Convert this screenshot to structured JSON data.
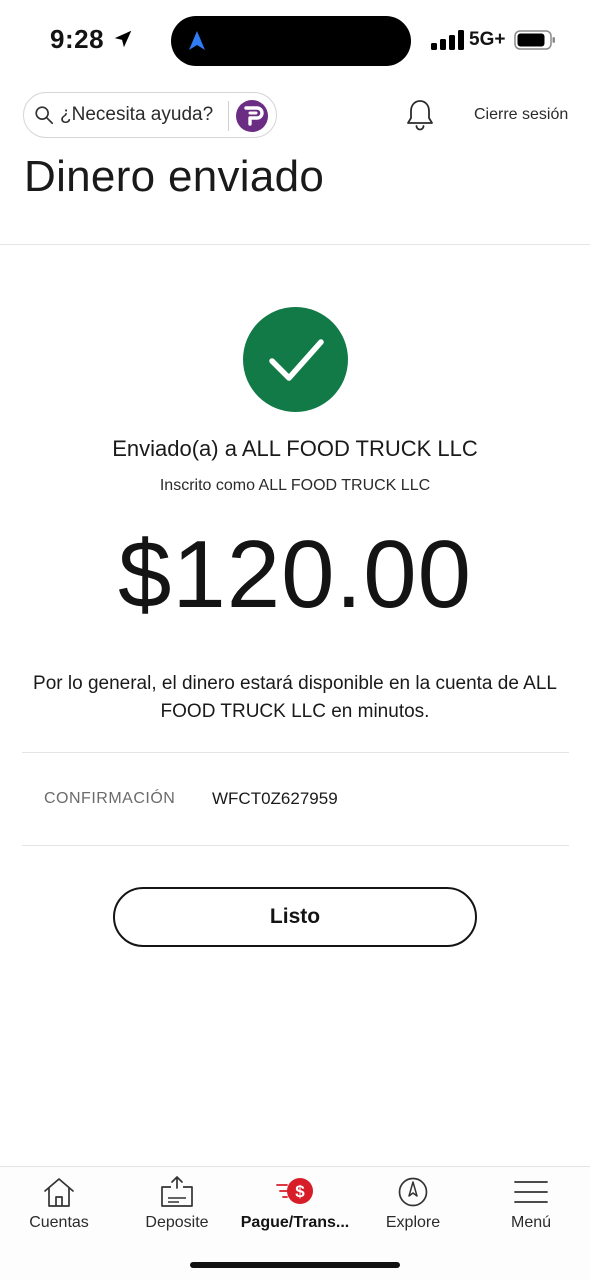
{
  "status_bar": {
    "time": "9:28",
    "network": "5G+"
  },
  "header": {
    "search_placeholder": "¿Necesita ayuda?",
    "logout_label": "Cierre sesión",
    "page_title": "Dinero enviado"
  },
  "confirmation": {
    "sent_to": "Enviado(a) a ALL FOOD TRUCK LLC",
    "enrolled_as": "Inscrito como ALL FOOD TRUCK LLC",
    "amount": "$120.00",
    "availability_note": "Por lo general, el dinero estará disponible en la cuenta de ALL FOOD TRUCK LLC en minutos.",
    "confirmation_label": "CONFIRMACIÓN",
    "confirmation_number": "WFCT0Z627959",
    "done_label": "Listo",
    "success_color": "#117a46"
  },
  "bottom_nav": {
    "items": [
      {
        "label": "Cuentas",
        "icon": "home-icon"
      },
      {
        "label": "Deposite",
        "icon": "deposit-icon"
      },
      {
        "label": "Pague/Trans...",
        "icon": "pay-transfer-icon",
        "active": true
      },
      {
        "label": "Explore",
        "icon": "compass-icon"
      },
      {
        "label": "Menú",
        "icon": "hamburger-menu-icon"
      }
    ],
    "accent_color": "#d71e28"
  }
}
